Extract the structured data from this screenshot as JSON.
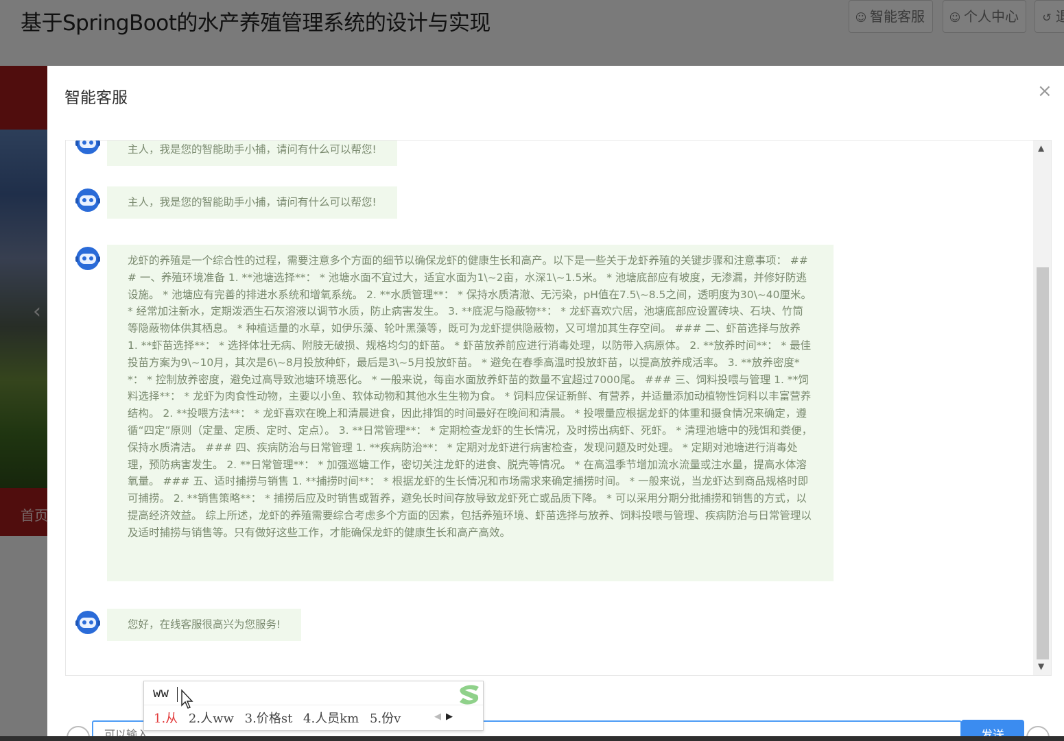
{
  "app": {
    "title": "基于SpringBoot的水产养殖管理系统的设计与实现",
    "buttons": [
      {
        "label": "智能客服",
        "icon": "user-icon"
      },
      {
        "label": "个人中心",
        "icon": "user-icon"
      },
      {
        "label": "退",
        "icon": "return-icon"
      }
    ],
    "home_label": "首页"
  },
  "dialog": {
    "title": "智能客服",
    "close_glyph": "×",
    "messages": [
      {
        "text": "主人，我是您的智能助手小捕，请问有什么可以帮您!"
      },
      {
        "text": "主人，我是您的智能助手小捕，请问有什么可以帮您!"
      },
      {
        "text": "龙虾的养殖是一个综合性的过程，需要注意多个方面的细节以确保龙虾的健康生长和高产。以下是一些关于龙虾养殖的关键步骤和注意事项： ### 一、养殖环境准备 1. **池塘选择**： * 池塘水面不宜过大，适宜水面为1\\~2亩，水深1\\~1.5米。 * 池塘底部应有坡度，无渗漏，并修好防逃设施。 * 池塘应有完善的排进水系统和增氧系统。 2. **水质管理**： * 保持水质清澈、无污染，pH值在7.5\\~8.5之间，透明度为30\\~40厘米。 * 经常加注新水，定期泼洒生石灰溶液以调节水质，防止病害发生。 3. **底泥与隐蔽物**： * 龙虾喜欢穴居，池塘底部应设置砖块、石块、竹筒等隐蔽物体供其栖息。 * 种植适量的水草，如伊乐藻、轮叶黑藻等，既可为龙虾提供隐蔽物，又可增加其生存空间。 ### 二、虾苗选择与放养 1. **虾苗选择**： * 选择体壮无病、附肢无破损、规格均匀的虾苗。 * 虾苗放养前应进行消毒处理，以防带入病原体。 2. **放养时间**： * 最佳投苗方案为9\\~10月，其次是6\\~8月投放种虾，最后是3\\~5月投放虾苗。 * 避免在春季高温时投放虾苗，以提高放养成活率。 3. **放养密度**： * 控制放养密度，避免过高导致池塘环境恶化。 * 一般来说，每亩水面放养虾苗的数量不宜超过7000尾。 ### 三、饲料投喂与管理 1. **饲料选择**： * 龙虾为肉食性动物，主要以小鱼、软体动物和其他水生生物为食。 * 饲料应保证新鲜、有营养，并适量添加动植物性饲料以丰富营养结构。 2. **投喂方法**： * 龙虾喜欢在晚上和清晨进食，因此排饵的时间最好在晚间和清晨。 * 投喂量应根据龙虾的体重和摄食情况来确定，遵循“四定”原则（定量、定质、定时、定点）。 3. **日常管理**： * 定期检查龙虾的生长情况，及时捞出病虾、死虾。 * 清理池塘中的残饵和粪便，保持水质清洁。 ### 四、疾病防治与日常管理 1. **疾病防治**： * 定期对龙虾进行病害检查，发现问题及时处理。 * 定期对池塘进行消毒处理，预防病害发生。 2. **日常管理**： * 加强巡塘工作，密切关注龙虾的进食、脱壳等情况。 * 在高温季节增加流水流量或注水量，提高水体溶氧量。 ### 五、适时捕捞与销售 1. **捕捞时间**： * 根据龙虾的生长情况和市场需求来确定捕捞时间。 * 一般来说，当龙虾达到商品规格时即可捕捞。 2. **销售策略**： * 捕捞后应及时销售或暂养，避免长时间存放导致龙虾死亡或品质下降。 * 可以采用分期分批捕捞和销售的方式，以提高经济效益。 综上所述，龙虾的养殖需要综合考虑多个方面的因素，包括养殖环境、虾苗选择与放养、饲料投喂与管理、疾病防治与日常管理以及适时捕捞与销售等。只有做好这些工作，才能确保龙虾的健康生长和高产高效。"
      },
      {
        "text": "您好，在线客服很高兴为您服务!"
      }
    ],
    "input_placeholder": "可以输入",
    "send_label": "发送"
  },
  "ime": {
    "composition": "ww",
    "candidates": [
      "1.从",
      "2.人ww",
      "3.价格st",
      "4.人员km",
      "5.份v"
    ]
  }
}
